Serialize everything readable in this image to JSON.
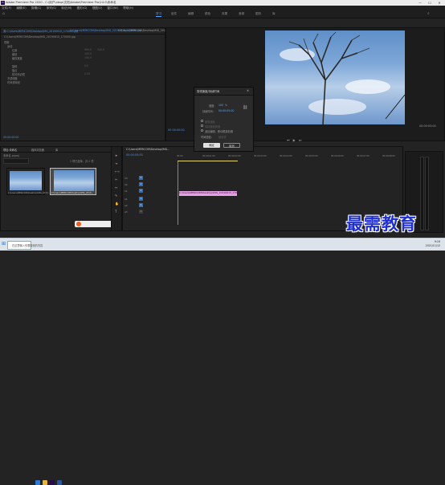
{
  "window": {
    "title": "Adobe Premiere Pro 2020 - C:\\用户\\nbsp\\文档\\Adobe\\Premiere Pro\\14.0\\未命名",
    "min": "—",
    "max": "☐",
    "close": "✕"
  },
  "menu": [
    "文件(F)",
    "编辑(E)",
    "剪辑(C)",
    "序列(S)",
    "标记(M)",
    "图形(G)",
    "视图(V)",
    "窗口(W)",
    "帮助(H)"
  ],
  "workspaces": [
    "学习",
    "组件",
    "编辑",
    "颜色",
    "效果",
    "音频",
    "图形",
    "库"
  ],
  "effect_controls": {
    "tabs": [
      "源:C:\\Users\\MERICOM\\Desktop\\IMG_20190615_170000.jpg",
      "C:\\Users\\MERICOM\\Desktop\\IMG_20190615_170000.jpg",
      "C:\\Users\\MERICOM\\Desktop\\IMG_20190615_170000.jpg"
    ],
    "clip_name": "C:\\Users\\MERICOM\\Desktop\\IMG_20190615_170000.jpg",
    "section": "视频",
    "rows": [
      "运动",
      "位置",
      "缩放",
      "缩放宽度",
      "旋转",
      "锚点",
      "防闪烁滤镜",
      "不透明度",
      "时间重映射"
    ],
    "values": [
      "960.0",
      "540.0",
      "100.0",
      "100.0",
      "0.0",
      "0.00"
    ],
    "timecode_bottom": "00:00:00:00"
  },
  "program_monitor": {
    "timecode_left": "00:00:00:00",
    "timecode_right": "00:00:05:00",
    "clip_bar": "00:00:05:00"
  },
  "dialog": {
    "title": "剪辑速度/持续时间",
    "speed_label": "速度:",
    "speed_value": "100",
    "speed_unit": "%",
    "duration_label": "持续时间:",
    "duration_value": "00:00:05:00",
    "chk1": "倒放速度",
    "chk2": "保持音频音调",
    "chk3": "波纹编辑，移动尾部剪辑",
    "interp_label": "时间插值:",
    "interp_value": "帧采样",
    "ok": "确定",
    "cancel": "取消"
  },
  "project": {
    "tabs": [
      "项目:未命名",
      "媒体浏览器",
      "库"
    ],
    "name": "未命名.prproj",
    "count": "1 项已选择，共 2 项",
    "items": [
      {
        "name": "C:\\Users\\MERICOM\\Desktop\\IMG_2019...",
        "dur": "5:00"
      },
      {
        "name": "C:\\Users\\MERICOM\\Desktop\\IMG_2019...",
        "dur": "5:00"
      }
    ]
  },
  "timeline": {
    "tab": "C:\\Users\\MERICOM\\Desktop\\IMG...",
    "timecode": "00:00:00:00",
    "ruler": [
      "00:00",
      "00:00:01:00",
      "00:00:02:00",
      "00:00:03:00",
      "00:00:04:00",
      "00:00:05:00",
      "00:00:06:00",
      "00:00:07:00",
      "00:00:08:00"
    ],
    "tracks": [
      "V3",
      "V2",
      "V1",
      "A1",
      "A2",
      "A3"
    ],
    "clip_label": "C:\\Users\\MERICOM\\Desktop\\IMG_20190615_170000.jpg"
  },
  "watermark": "最需教育",
  "taskbar": {
    "search": "在这里输入你要搜索的内容",
    "time": "9:16",
    "date": "2021/11/12"
  },
  "colors": {
    "accent": "#5aa6ff",
    "clip": "#e6a0e6",
    "brand": "#2030d0"
  }
}
